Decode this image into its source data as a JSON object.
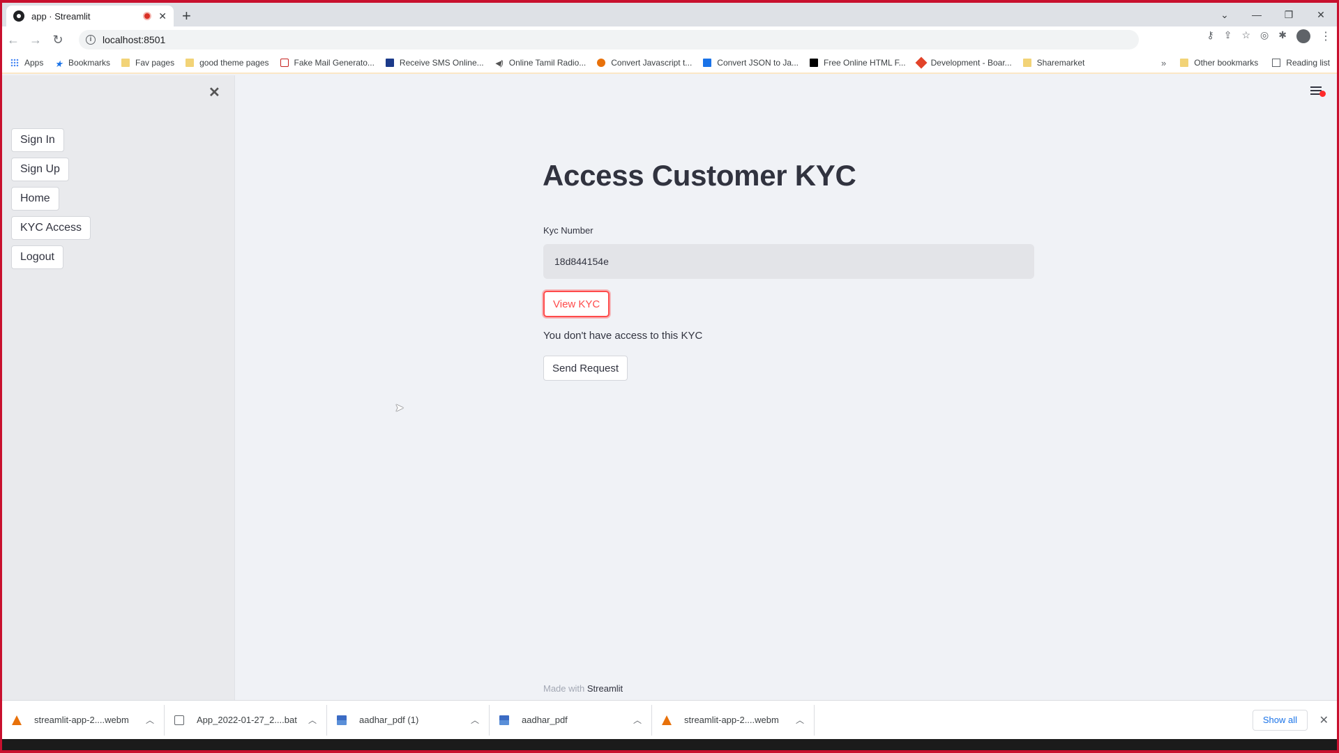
{
  "browser": {
    "tab_title": "app · Streamlit",
    "new_tab": "+",
    "url": "localhost:8501",
    "window_controls": [
      "⌄",
      "—",
      "❐",
      "✕"
    ]
  },
  "bookmarks": {
    "items": [
      {
        "label": "Apps",
        "icon": "apps-grid-icon"
      },
      {
        "label": "Bookmarks",
        "icon": "star-icon"
      },
      {
        "label": "Fav pages",
        "icon": "folder-icon"
      },
      {
        "label": "good theme pages",
        "icon": "folder-icon"
      },
      {
        "label": "Fake Mail Generato...",
        "icon": "mail-icon"
      },
      {
        "label": "Receive SMS Online...",
        "icon": "envelope-icon"
      },
      {
        "label": "Online Tamil Radio...",
        "icon": "radio-icon"
      },
      {
        "label": "Convert Javascript t...",
        "icon": "js-icon"
      },
      {
        "label": "Convert JSON to Ja...",
        "icon": "json-icon"
      },
      {
        "label": "Free Online HTML F...",
        "icon": "ff-icon"
      },
      {
        "label": "Development - Boar...",
        "icon": "gitlab-icon"
      },
      {
        "label": "Sharemarket",
        "icon": "folder-icon"
      }
    ],
    "overflow": "»",
    "other": "Other bookmarks",
    "reading_list": "Reading list"
  },
  "sidebar": {
    "close": "✕",
    "items": [
      {
        "label": "Sign In"
      },
      {
        "label": "Sign Up"
      },
      {
        "label": "Home"
      },
      {
        "label": "KYC Access"
      },
      {
        "label": "Logout"
      }
    ]
  },
  "main": {
    "title": "Access Customer KYC",
    "kyc_label": "Kyc Number",
    "kyc_value": "18d844154e",
    "view_button": "View KYC",
    "no_access_message": "You don't have access to this KYC",
    "send_request_button": "Send Request",
    "footer_prefix": "Made with ",
    "footer_brand": "Streamlit"
  },
  "downloads": {
    "items": [
      {
        "name": "streamlit-app-2....webm",
        "icon": "vlc-icon"
      },
      {
        "name": "App_2022-01-27_2....bat",
        "icon": "bat-file-icon"
      },
      {
        "name": "aadhar_pdf (1)",
        "icon": "pdf-file-icon"
      },
      {
        "name": "aadhar_pdf",
        "icon": "pdf-file-icon"
      },
      {
        "name": "streamlit-app-2....webm",
        "icon": "vlc-icon"
      }
    ],
    "show_all": "Show all",
    "close": "✕"
  },
  "colors": {
    "accent": "#ff4b4b",
    "sidebar_bg": "#e9eaed",
    "main_bg": "#f0f2f6",
    "text": "#31333f"
  }
}
